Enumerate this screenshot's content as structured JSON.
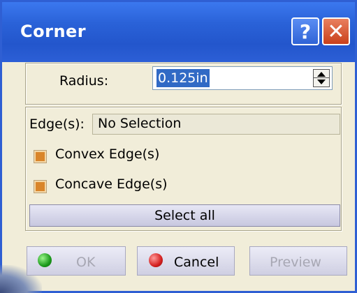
{
  "window": {
    "title": "Corner",
    "help_label": "?",
    "close_label": "✕"
  },
  "radius": {
    "label": "Radius:",
    "value": "0.125in"
  },
  "edges": {
    "label": "Edge(s):",
    "selection": "No Selection",
    "convex_label": "Convex Edge(s)",
    "convex_checked": true,
    "concave_label": "Concave Edge(s)",
    "concave_checked": true,
    "select_all_label": "Select all"
  },
  "buttons": {
    "ok_label": "OK",
    "ok_enabled": false,
    "cancel_label": "Cancel",
    "cancel_enabled": true,
    "preview_label": "Preview",
    "preview_enabled": false
  },
  "icons": {
    "ok": "green-ball-icon",
    "cancel": "red-ball-icon",
    "help": "help-icon",
    "close": "close-icon",
    "spinner": "spinner-icon"
  },
  "colors": {
    "titlebar": "#2356cc",
    "dialog_background": "#f1edd9",
    "selection_highlight": "#316ac5",
    "checkbox": "#d9852a"
  }
}
